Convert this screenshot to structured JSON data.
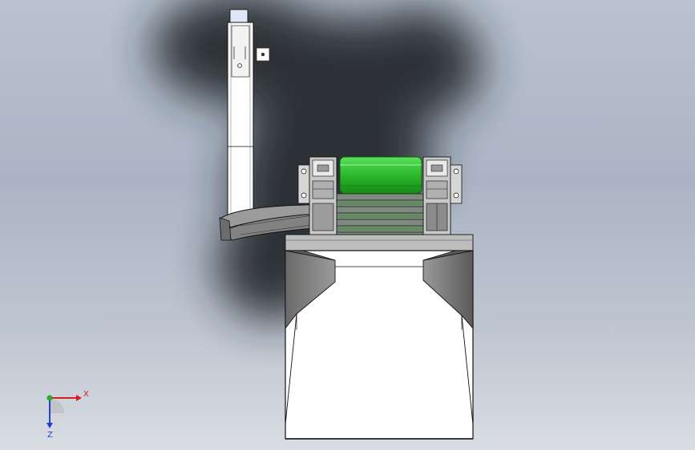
{
  "app": {
    "view": "cad-3d-viewport",
    "model": "conveyor-hopper-assembly"
  },
  "colors": {
    "background_top": "#b8c2d0",
    "background_bottom": "#d9dde3",
    "roller_green": "#22a52a",
    "roller_green_light": "#5ee05e",
    "metal_gray": "#8d8d8d",
    "dark_gray": "#4a4a4a",
    "outline": "#111111",
    "axis_x": "#d42020",
    "axis_y": "#25b025",
    "axis_z": "#2040d0"
  },
  "triad": {
    "x_label": "X",
    "z_label": "Z"
  }
}
